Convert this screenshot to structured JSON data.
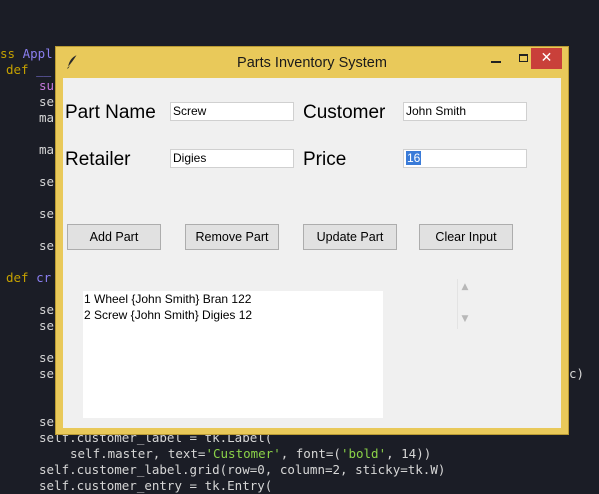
{
  "window": {
    "title": "Parts Inventory System",
    "controls": {
      "minimize": "minimize",
      "maximize": "maximize",
      "close": "✕"
    }
  },
  "form": {
    "part_name_label": "Part Name",
    "part_name_value": "Screw",
    "customer_label": "Customer",
    "customer_value": "John Smith",
    "retailer_label": "Retailer",
    "retailer_value": "Digies",
    "price_label": "Price",
    "price_value": "16"
  },
  "buttons": {
    "add": "Add Part",
    "remove": "Remove Part",
    "update": "Update Part",
    "clear": "Clear Input"
  },
  "parts_list": [
    "1 Wheel {John Smith} Bran 122",
    "2 Screw {John Smith} Digies 12"
  ],
  "background_code": {
    "line1_kw": "ss",
    "line1_name": "Appl",
    "line2_kw": "def",
    "line2_rest": "__",
    "line3": "su",
    "line4": "se",
    "line5": "ma",
    "line6": "ma",
    "line7": "se",
    "line8": "se",
    "line9": "se",
    "line10_kw": "def",
    "line10_rest": "cr",
    "line11": "se",
    "line12": "se",
    "line13": "se",
    "line14": "se",
    "line15": "se",
    "line_right": "c)",
    "line16": "self.customer_label = tk.Label(",
    "line17_a": "self.master, text=",
    "line17_str": "'Customer'",
    "line17_b": ", font=(",
    "line17_str2": "'bold'",
    "line17_c": ", 14))",
    "line18": "self.customer_label.grid(row=0, column=2, sticky=tk.W)",
    "line19": "self.customer_entry = tk.Entry("
  },
  "colors": {
    "editor_bg": "#1b1d26",
    "window_frame": "#e9c95a",
    "close_button": "#c9403a",
    "selection": "#3a7bd8"
  }
}
